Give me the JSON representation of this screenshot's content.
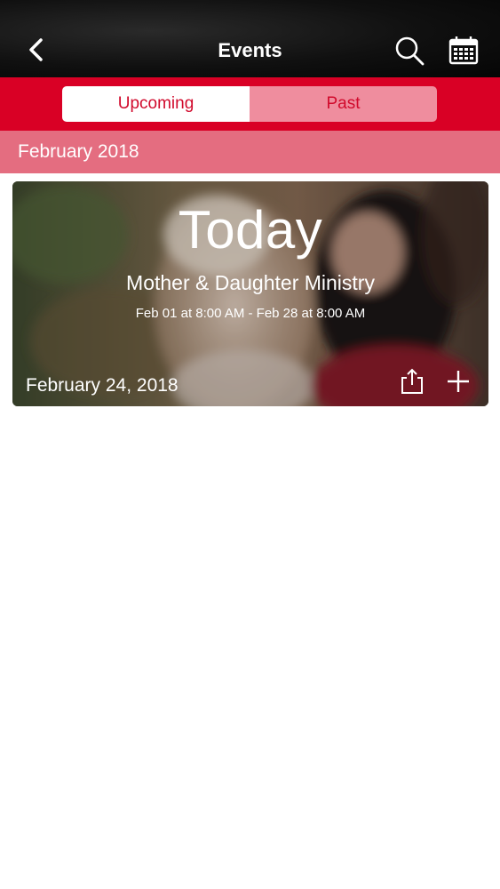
{
  "header": {
    "title": "Events",
    "back_icon": "chevron-left-icon",
    "search_icon": "search-icon",
    "calendar_icon": "calendar-icon"
  },
  "tabs": [
    {
      "label": "Upcoming",
      "active": true
    },
    {
      "label": "Past",
      "active": false
    }
  ],
  "section": {
    "month": "February 2018"
  },
  "events": [
    {
      "badge": "Today",
      "name": "Mother & Daughter Ministry",
      "range": "Feb 01 at 8:00 AM - Feb 28 at 8:00 AM",
      "date": "February 24, 2018",
      "share_icon": "share-icon",
      "add_icon": "plus-icon"
    }
  ],
  "colors": {
    "accent": "#d90025",
    "tab_text": "#d10a2c",
    "tab_inactive": "#ef8d9e",
    "month_bar": "#e46d80",
    "header_bg": "#0a0a0a"
  }
}
